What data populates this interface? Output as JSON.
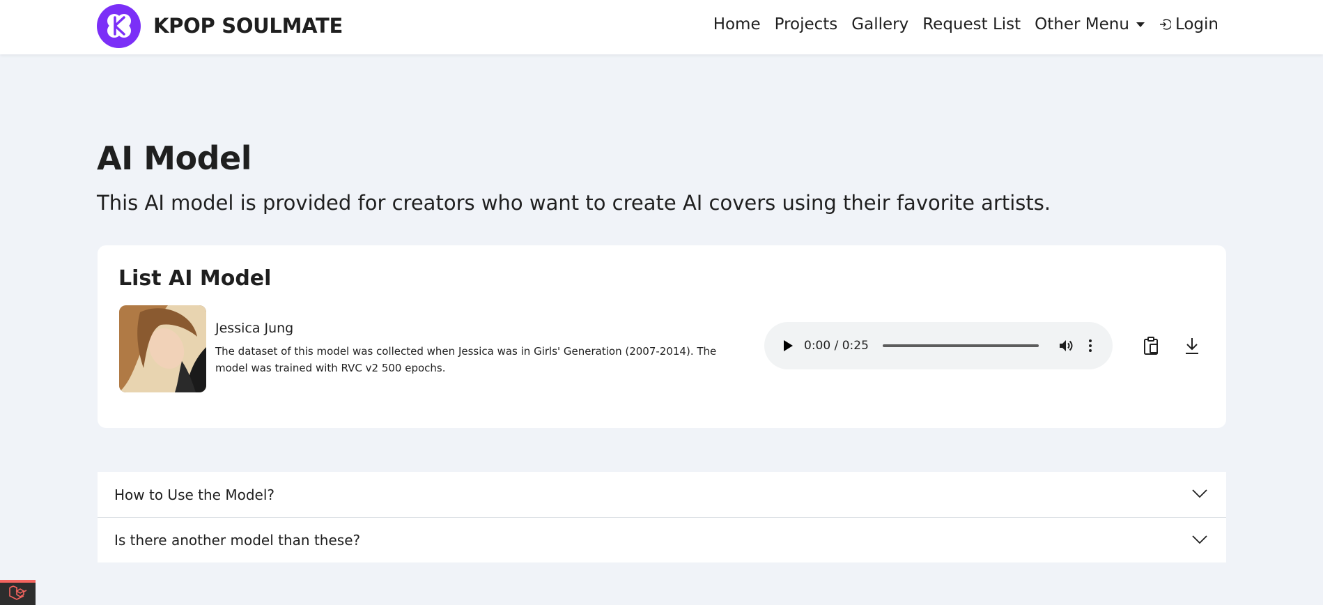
{
  "navbar": {
    "brand_name": "KPOP SOULMATE",
    "logo_icon": "kpop-soulmate-logo",
    "brand_color": "#7b2ff7",
    "links": {
      "home": "Home",
      "projects": "Projects",
      "gallery": "Gallery",
      "request_list": "Request List",
      "other_menu": "Other Menu",
      "login": "Login"
    }
  },
  "hero": {
    "title": "AI Model",
    "subtitle": "This AI model is provided for creators who want to create AI covers using their favorite artists."
  },
  "model_list": {
    "title": "List AI Model",
    "items": [
      {
        "name": "Jessica Jung",
        "description": "The dataset of this model was collected when Jessica was in Girls' Generation (2007-2014). The model was trained with RVC v2 500 epochs.",
        "audio": {
          "time_display": "0:00 / 0:25",
          "progress": 0
        },
        "actions": [
          "clipboard-icon",
          "download-icon"
        ]
      }
    ]
  },
  "faq": {
    "items": [
      {
        "question": "How to Use the Model?"
      },
      {
        "question": "Is there another model than these?"
      }
    ]
  },
  "debug_tab": {
    "icon": "laravel-icon",
    "accent": "#f4645f"
  }
}
